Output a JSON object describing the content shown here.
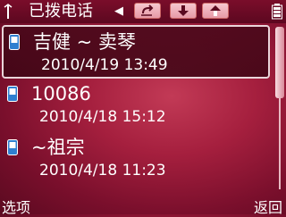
{
  "header": {
    "title": "已拨电话",
    "nav_left_glyph": "◀"
  },
  "calls": [
    {
      "name": "吉健 ~ 卖琴",
      "time": "2010/4/19 13:49"
    },
    {
      "name": "10086",
      "time": "2010/4/18 15:12"
    },
    {
      "name": "~祖宗",
      "time": "2010/4/18 11:23"
    }
  ],
  "softkeys": {
    "left": "选项",
    "right": "返回"
  },
  "colors": {
    "background": "#a51f3e",
    "selected_row": "#46081a",
    "text": "#ffffff"
  },
  "icons": [
    "signal-icon",
    "back-arrow-icon",
    "down-arrow-icon",
    "up-arrow-icon",
    "battery-icon",
    "phone-icon"
  ]
}
